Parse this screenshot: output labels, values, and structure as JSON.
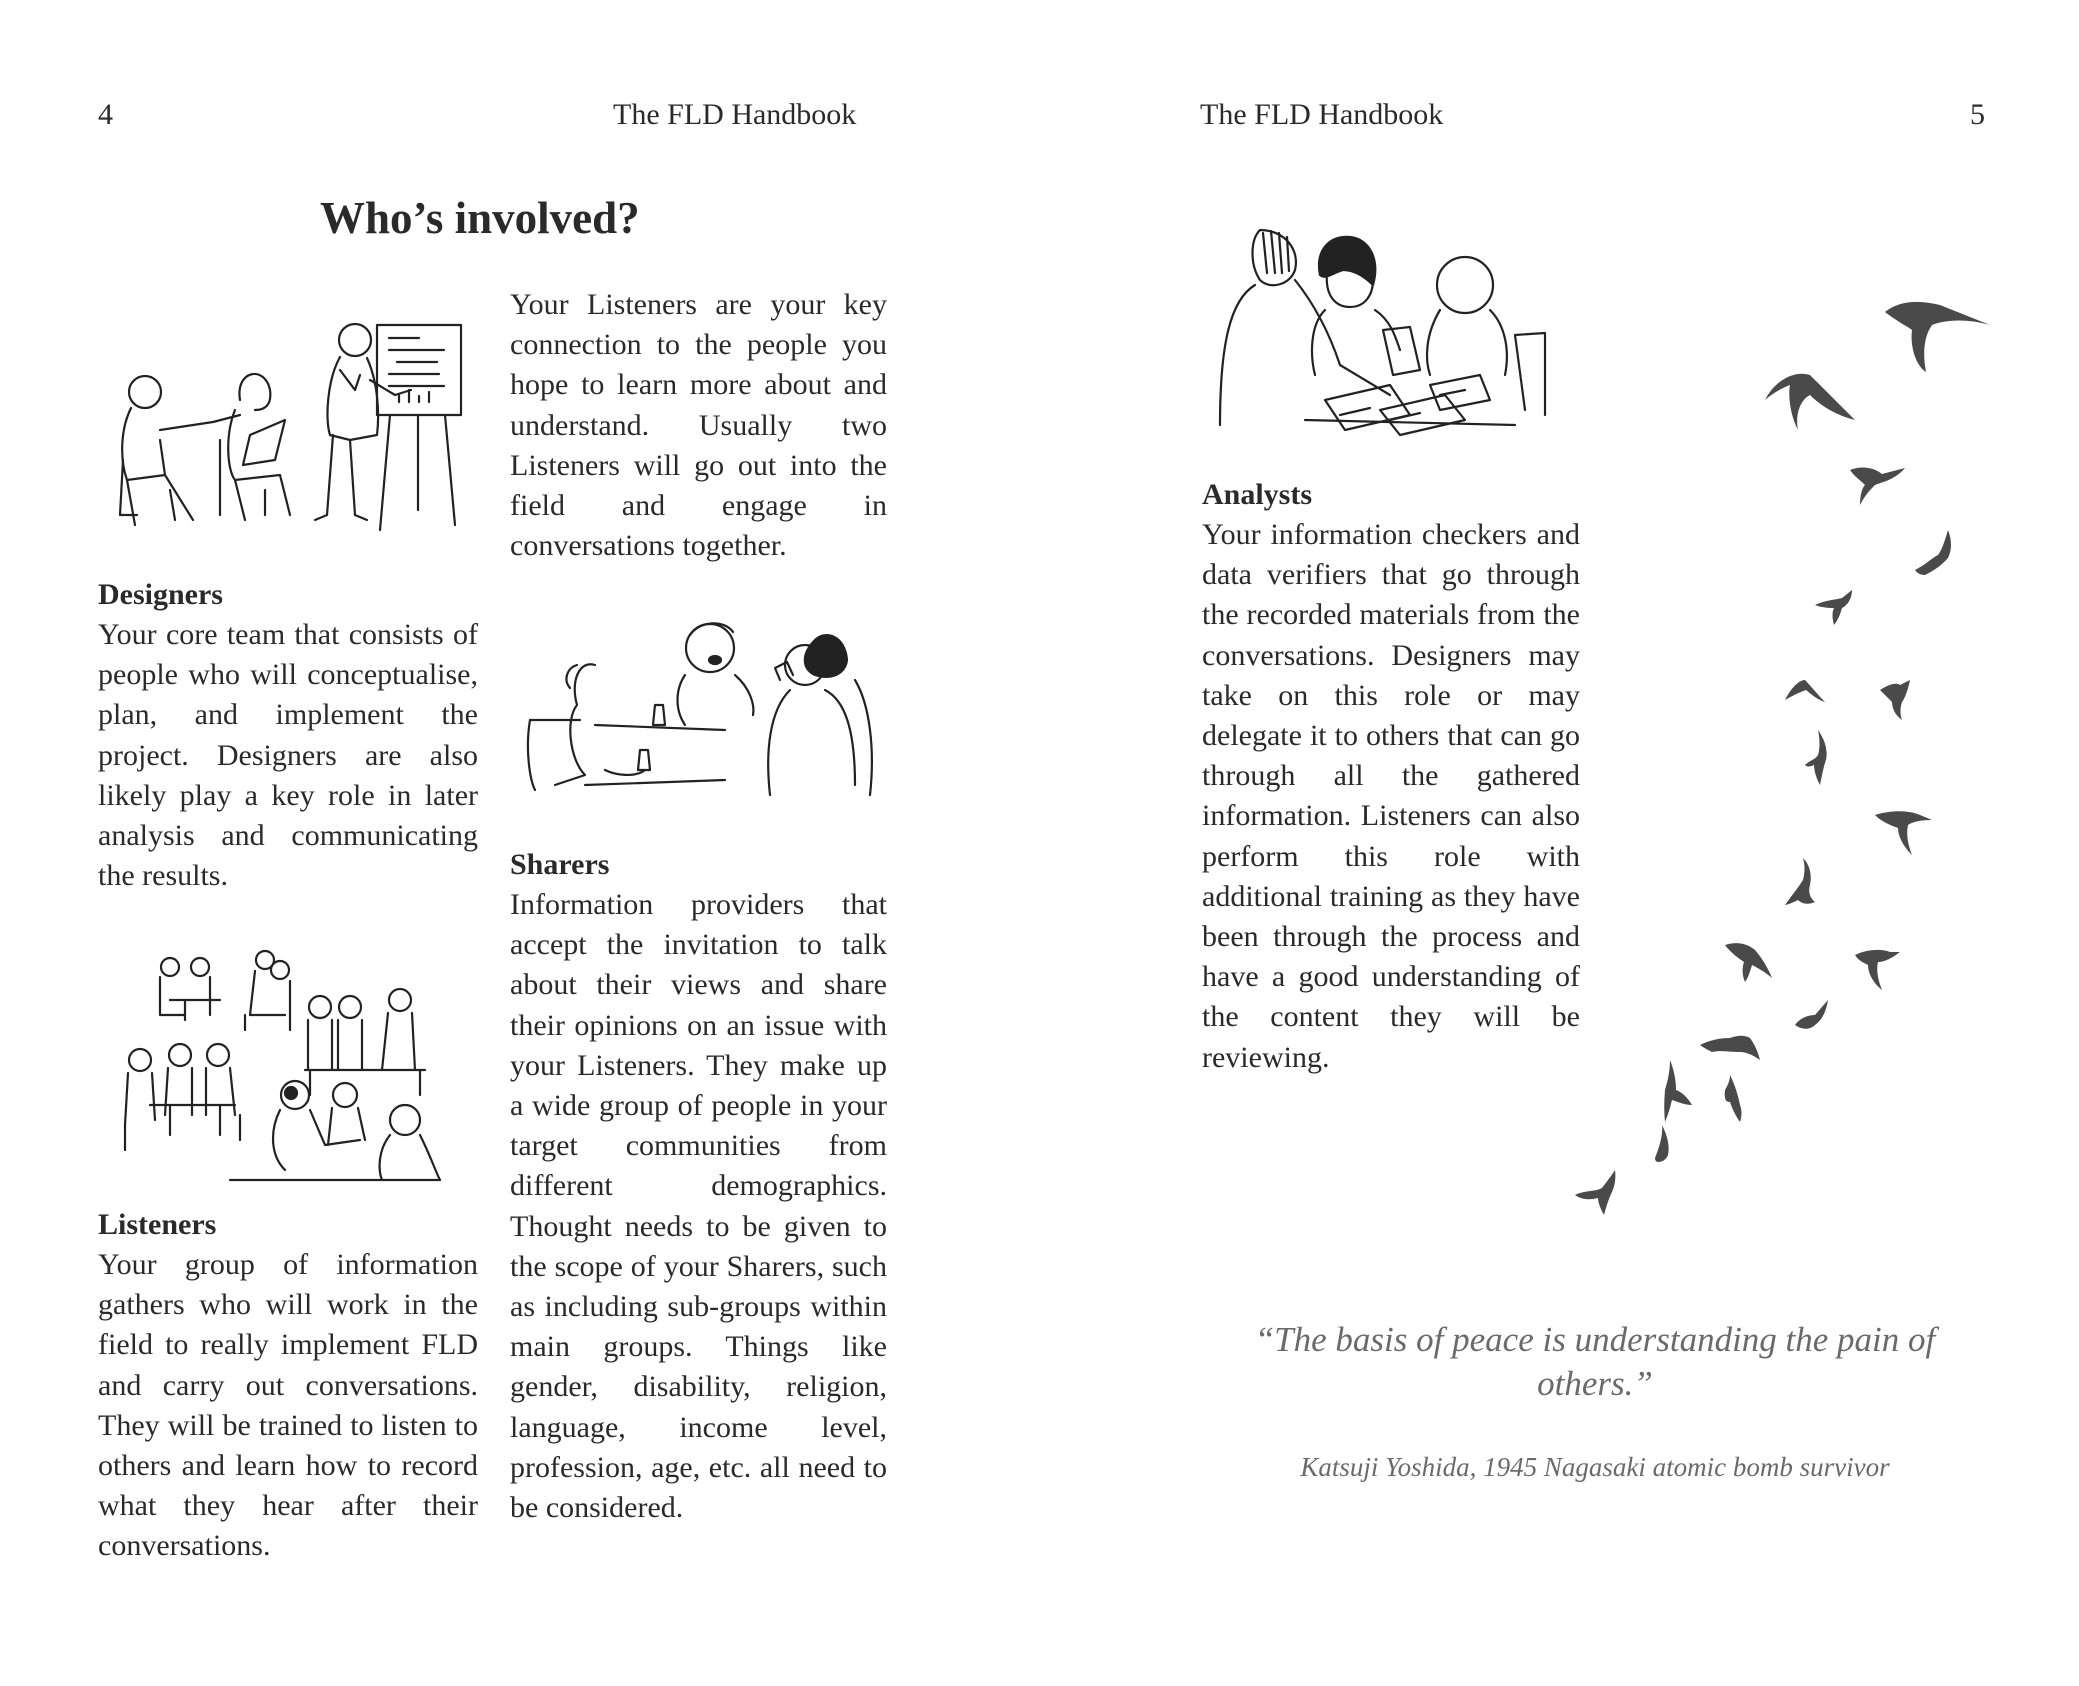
{
  "header": {
    "left_page_number": "4",
    "left_running_title": "The FLD Handbook",
    "right_running_title": "The FLD Handbook",
    "right_page_number": "5"
  },
  "section_title": "Who’s involved?",
  "roles": {
    "designers": {
      "heading": "Designers",
      "text": "Your core team that consists of people who will conceptualise, plan, and implement the project. Designers are also likely play a key role in later analysis and communicating the results."
    },
    "listeners": {
      "intro": "Your Listeners are your key connection to the people you hope to learn more about and understand. Usually two Listeners will go out into the field and engage in conversations together.",
      "heading": "Listeners",
      "text": "Your group of information gathers who will work in the field to really implement FLD and carry out conversations. They will be trained to listen to others and learn how to record what they hear after their conversations."
    },
    "sharers": {
      "heading": "Sharers",
      "text": "Information providers that accept the invitation to talk about their views and share their opinions on an issue with your Listeners. They make up a wide group of people in your target communities from different demographics. Thought needs to be given to the scope of your Sharers, such as including sub-groups within main groups. Things like gender, disability, religion, language, income level, profession, age, etc. all need to be considered."
    },
    "analysts": {
      "heading": "Analysts",
      "text": "Your information checkers and data verifiers that go through the recorded materials from the conversations. Designers may take on this role or may delegate it to others that can go through all the gathered information. Listeners can also perform this role with additional training as they have been through the process and have a good understanding of the content they will be reviewing."
    }
  },
  "quote": {
    "text": "“The basis of peace is understanding the pain of others.”",
    "attribution": "Katsuji Yoshida, 1945 Nagasaki atomic bomb survivor"
  },
  "illustrations": [
    "designers-illustration",
    "sharers-illustration",
    "listeners-illustration",
    "analysts-illustration",
    "birds-illustration"
  ],
  "colors": {
    "text": "#2a2a2a",
    "quote": "#6a6a6a",
    "birds": "#4a4a4a"
  }
}
